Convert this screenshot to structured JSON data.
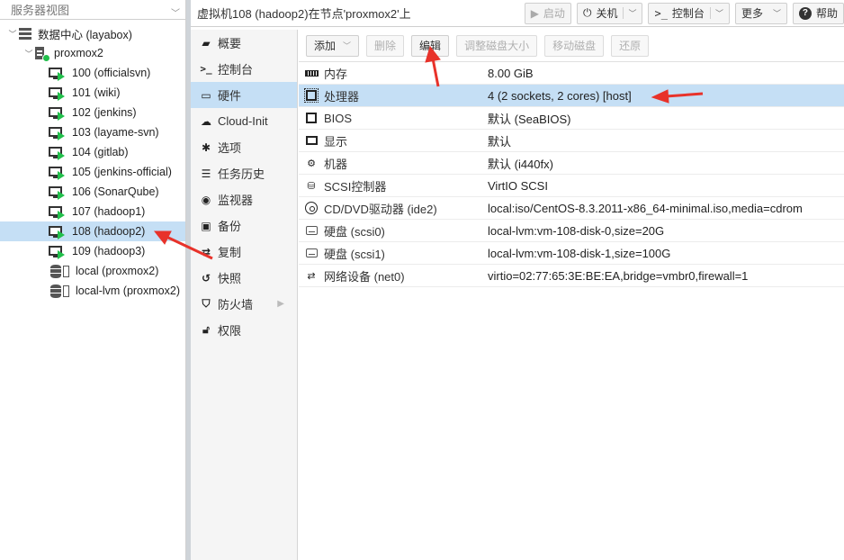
{
  "tree": {
    "header": "服务器视图",
    "datacenter": "数据中心 (layabox)",
    "node": "proxmox2",
    "vms": [
      {
        "label": "100 (officialsvn)"
      },
      {
        "label": "101 (wiki)"
      },
      {
        "label": "102 (jenkins)"
      },
      {
        "label": "103 (layame-svn)"
      },
      {
        "label": "104 (gitlab)"
      },
      {
        "label": "105 (jenkins-official)"
      },
      {
        "label": "106 (SonarQube)"
      },
      {
        "label": "107 (hadoop1)"
      },
      {
        "label": "108 (hadoop2)"
      },
      {
        "label": "109 (hadoop3)"
      }
    ],
    "storages": [
      {
        "label": "local (proxmox2)"
      },
      {
        "label": "local-lvm (proxmox2)"
      }
    ],
    "selected_index": 8
  },
  "topbar": {
    "title": "虚拟机108 (hadoop2)在节点'proxmox2'上",
    "start": "启动",
    "shutdown": "关机",
    "console": "控制台",
    "more": "更多",
    "help": "帮助"
  },
  "nav": {
    "items": [
      {
        "label": "概要",
        "icon": "book-icon"
      },
      {
        "label": "控制台",
        "icon": "terminal-icon"
      },
      {
        "label": "硬件",
        "icon": "desktop-icon"
      },
      {
        "label": "Cloud-Init",
        "icon": "cloud-icon"
      },
      {
        "label": "选项",
        "icon": "gear-icon"
      },
      {
        "label": "任务历史",
        "icon": "list-icon"
      },
      {
        "label": "监视器",
        "icon": "eye-icon"
      },
      {
        "label": "备份",
        "icon": "floppy-icon"
      },
      {
        "label": "复制",
        "icon": "retweet-icon"
      },
      {
        "label": "快照",
        "icon": "history-icon"
      },
      {
        "label": "防火墙",
        "icon": "shield-icon"
      },
      {
        "label": "权限",
        "icon": "unlock-icon"
      }
    ],
    "active_index": 2
  },
  "hw_toolbar": {
    "add": "添加",
    "remove": "删除",
    "edit": "编辑",
    "resize": "调整磁盘大小",
    "move": "移动磁盘",
    "revert": "还原"
  },
  "hardware": [
    {
      "key": "内存",
      "value": "8.00 GiB",
      "icon": "memory-icon"
    },
    {
      "key": "处理器",
      "value": "4 (2 sockets, 2 cores) [host]",
      "icon": "cpu-icon"
    },
    {
      "key": "BIOS",
      "value": "默认 (SeaBIOS)",
      "icon": "microchip-icon"
    },
    {
      "key": "显示",
      "value": "默认",
      "icon": "monitor-icon"
    },
    {
      "key": "机器",
      "value": "默认 (i440fx)",
      "icon": "cogs-icon"
    },
    {
      "key": "SCSI控制器",
      "value": "VirtIO SCSI",
      "icon": "database-icon"
    },
    {
      "key": "CD/DVD驱动器 (ide2)",
      "value": "local:iso/CentOS-8.3.2011-x86_64-minimal.iso,media=cdrom",
      "icon": "cdrom-icon"
    },
    {
      "key": "硬盘 (scsi0)",
      "value": "local-lvm:vm-108-disk-0,size=20G",
      "icon": "hdd-icon"
    },
    {
      "key": "硬盘 (scsi1)",
      "value": "local-lvm:vm-108-disk-1,size=100G",
      "icon": "hdd-icon"
    },
    {
      "key": "网络设备 (net0)",
      "value": "virtio=02:77:65:3E:BE:EA,bridge=vmbr0,firewall=1",
      "icon": "exchange-icon"
    }
  ],
  "colors": {
    "selection": "#c5dff5",
    "running": "#21bf4b",
    "annotation": "#e8322a"
  }
}
